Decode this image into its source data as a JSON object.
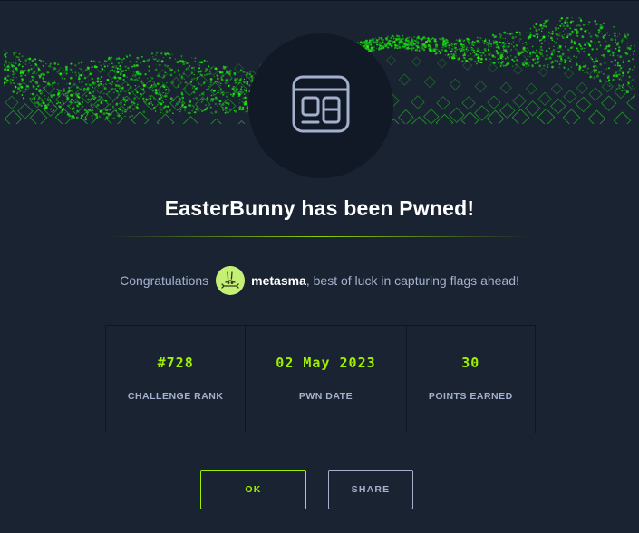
{
  "modal": {
    "title": "EasterBunny has been Pwned!",
    "icon": "web-window-icon",
    "congrats_prefix": "Congratulations",
    "username": "metasma",
    "congrats_suffix": ", best of luck in capturing flags ahead!",
    "avatar_icon": "bunny-avatar-icon"
  },
  "stats": [
    {
      "value": "#728",
      "label": "CHALLENGE RANK"
    },
    {
      "value": "02 May 2023",
      "label": "PWN DATE"
    },
    {
      "value": "30",
      "label": "POINTS EARNED"
    }
  ],
  "buttons": {
    "ok": "OK",
    "share": "SHARE"
  },
  "colors": {
    "accent": "#9fef00",
    "background": "#1a2332",
    "muted_text": "#a4b1cd"
  }
}
